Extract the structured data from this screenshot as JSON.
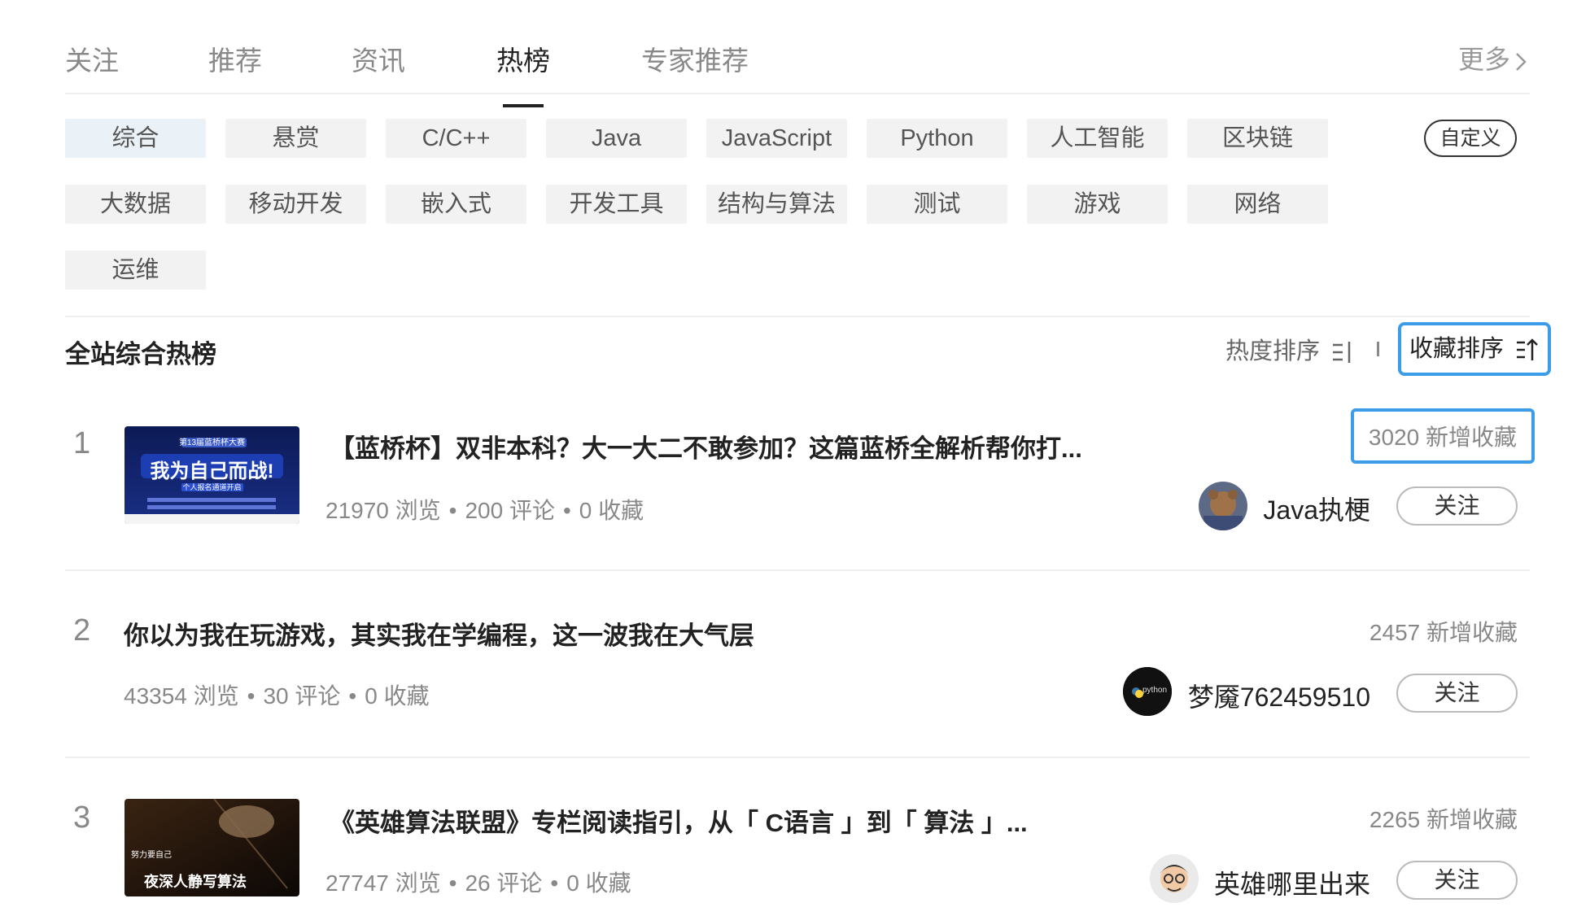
{
  "topnav": {
    "tabs": [
      {
        "label": "关注"
      },
      {
        "label": "推荐"
      },
      {
        "label": "资讯"
      },
      {
        "label": "热榜"
      },
      {
        "label": "专家推荐"
      }
    ],
    "active_tab": "热榜",
    "more_label": "更多"
  },
  "categories": {
    "chips": [
      "综合",
      "悬赏",
      "C/C++",
      "Java",
      "JavaScript",
      "Python",
      "人工智能",
      "区块链",
      "大数据",
      "移动开发",
      "嵌入式",
      "开发工具",
      "结构与算法",
      "测试",
      "游戏",
      "网络",
      "运维"
    ],
    "active": "综合",
    "custom_label": "自定义"
  },
  "section": {
    "title": "全站综合热榜",
    "sort_hot_label": "热度排序",
    "sort_fav_label": "收藏排序"
  },
  "items": [
    {
      "rank": "1",
      "thumb_text_top": "第13届蓝桥杯大赛",
      "thumb_text_main": "我为自己而战!",
      "thumb_text_sub": "个人报名通道开启",
      "title": "【蓝桥杯】双非本科？大一大二不敢参加？这篇蓝桥全解析帮你打...",
      "views": "21970 浏览",
      "comments": "200 评论",
      "favorites": "0 收藏",
      "new_favorites": "3020 新增收藏",
      "author": "Java执梗",
      "follow_label": "关注"
    },
    {
      "rank": "2",
      "title": "你以为我在玩游戏，其实我在学编程，这一波我在大气层",
      "views": "43354 浏览",
      "comments": "30 评论",
      "favorites": "0 收藏",
      "new_favorites": "2457 新增收藏",
      "author": "梦魇762459510",
      "avatar_text": "python",
      "follow_label": "关注"
    },
    {
      "rank": "3",
      "thumb_text_quote": "努力要自己",
      "thumb_text_main": "夜深人静写算法",
      "title": "《英雄算法联盟》专栏阅读指引，从「 C语言 」到「 算法 」...",
      "views": "27747 浏览",
      "comments": "26 评论",
      "favorites": "0 收藏",
      "new_favorites": "2265 新增收藏",
      "author": "英雄哪里出来",
      "follow_label": "关注"
    }
  ],
  "colors": {
    "accent_border": "#3d9ce8",
    "active_chip_bg": "#eaf2f7",
    "chip_bg": "#f2f2f2",
    "muted_text": "#888888"
  },
  "icons": [
    "chevron-right-icon",
    "sort-lines-icon",
    "sort-up-arrow-icon",
    "dot-separator-icon"
  ]
}
